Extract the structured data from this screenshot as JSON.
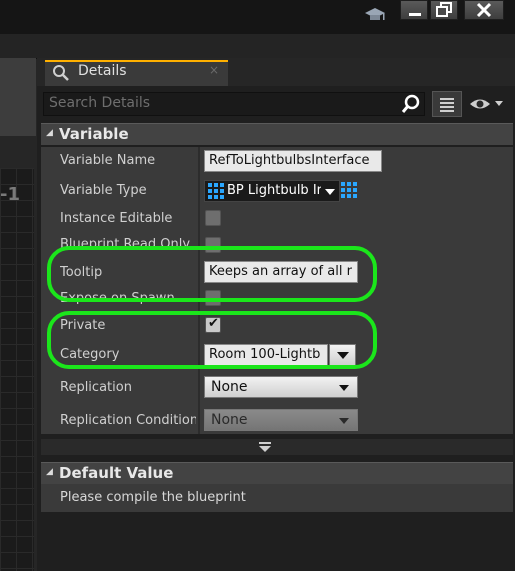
{
  "window": {
    "buttons": [
      "minimize",
      "maximize",
      "close"
    ]
  },
  "background": {
    "graph_label": "-1"
  },
  "tab": {
    "label": "Details",
    "close": "×"
  },
  "search": {
    "placeholder": "Search Details"
  },
  "sections": {
    "variable": "Variable",
    "default_value": "Default Value"
  },
  "variable": {
    "name_label": "Variable Name",
    "name_value": "RefToLightbulbsInterface",
    "type_label": "Variable Type",
    "type_value": "BP Lightbulb Ir",
    "instance_editable_label": "Instance Editable",
    "blueprint_read_only_label": "Blueprint Read Only",
    "tooltip_label": "Tooltip",
    "tooltip_value": "Keeps an array of all r",
    "expose_on_spawn_label": "Expose on Spawn",
    "private_label": "Private",
    "private_checked": true,
    "category_label": "Category",
    "category_value": "Room 100-Lightb",
    "replication_label": "Replication",
    "replication_value": "None",
    "replication_condition_label": "Replication Condition",
    "replication_condition_value": "None"
  },
  "default_value": {
    "message": "Please compile the blueprint"
  },
  "colors": {
    "highlight": "#1be61b",
    "tab_accent": "#ffb000",
    "grid_icon": "#2aa7ff"
  }
}
